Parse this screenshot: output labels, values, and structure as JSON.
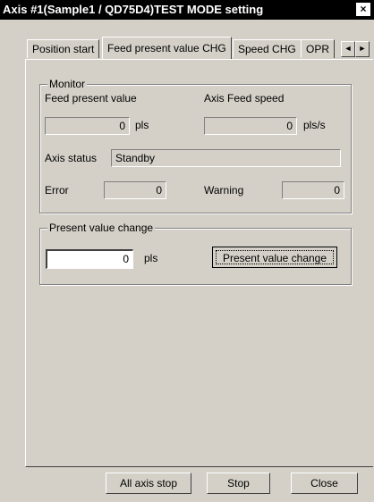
{
  "window": {
    "title": "Axis #1(Sample1 / QD75D4)TEST MODE setting",
    "close_glyph": "×"
  },
  "tabs": [
    {
      "label": "Position start",
      "active": false
    },
    {
      "label": "Feed present value CHG",
      "active": true
    },
    {
      "label": "Speed CHG",
      "active": false
    },
    {
      "label": "OPR",
      "active": false
    }
  ],
  "tab_scroll": {
    "left_icon": "◄",
    "right_icon": "►"
  },
  "monitor": {
    "title": "Monitor",
    "feed_present_value_label": "Feed present value",
    "feed_present_value": "0",
    "feed_present_value_unit": "pls",
    "axis_feed_speed_label": "Axis Feed speed",
    "axis_feed_speed": "0",
    "axis_feed_speed_unit": "pls/s",
    "axis_status_label": "Axis status",
    "axis_status": "Standby",
    "error_label": "Error",
    "error_value": "0",
    "warning_label": "Warning",
    "warning_value": "0"
  },
  "present_value_change": {
    "title": "Present value change",
    "input_value": "0",
    "unit": "pls",
    "button_label": "Present value change"
  },
  "footer": {
    "all_axis_stop": "All axis stop",
    "stop": "Stop",
    "close": "Close"
  }
}
